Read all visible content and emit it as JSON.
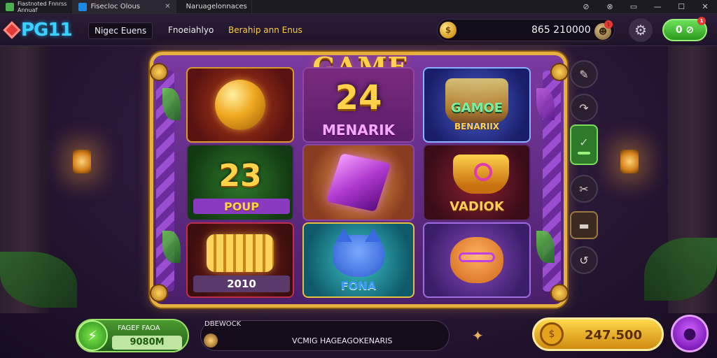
{
  "browser": {
    "tabs": [
      {
        "label": "Fiastnoted Fnnrss\nAnnuaf",
        "color": "#4caf50"
      },
      {
        "label": "Fisecloc Olous",
        "color": "#1e88e5"
      },
      {
        "label": "Naruagelonnaces",
        "color": "#c0602a"
      }
    ],
    "controls": [
      "⊘",
      "⊗",
      "▭",
      "—",
      "☐",
      "✕"
    ]
  },
  "header": {
    "logo_text": "PG11",
    "nav": [
      "Nigec Euens",
      "Fnoeiahlyo",
      "Berahip ann Enus"
    ],
    "balance": "865 210000",
    "notif_count": "1",
    "green_button": "0 ⊘"
  },
  "game": {
    "title": "GAME SLOK",
    "tiles": {
      "center_top_number": "24",
      "center_top_label": "MENARIK",
      "left_mid_number": "23",
      "left_mid_label": "POUP",
      "left_bottom_label": "2010",
      "center_bottom_label": "FONA",
      "right_top_label1": "GAMOE",
      "right_top_label2": "BENARIIX",
      "right_mid_label": "VADIOK"
    }
  },
  "side_icons": [
    "✎",
    "↷",
    "✓",
    "✂",
    "▬",
    "↺"
  ],
  "bottom": {
    "bet_label": "FAGEF FAOA",
    "bet_value": "9080M",
    "msg_label": "DBEWOCK",
    "msg_text": "VCMIG HAGEAGOKENARIS",
    "win_value": "247.500"
  },
  "colors": {
    "frame_gold": "#e6b040",
    "frame_purple": "#7a3aa0",
    "title_gold": "#ffd24a",
    "spin_purple": "#b040e8",
    "bet_green": "#4b9a2e"
  }
}
